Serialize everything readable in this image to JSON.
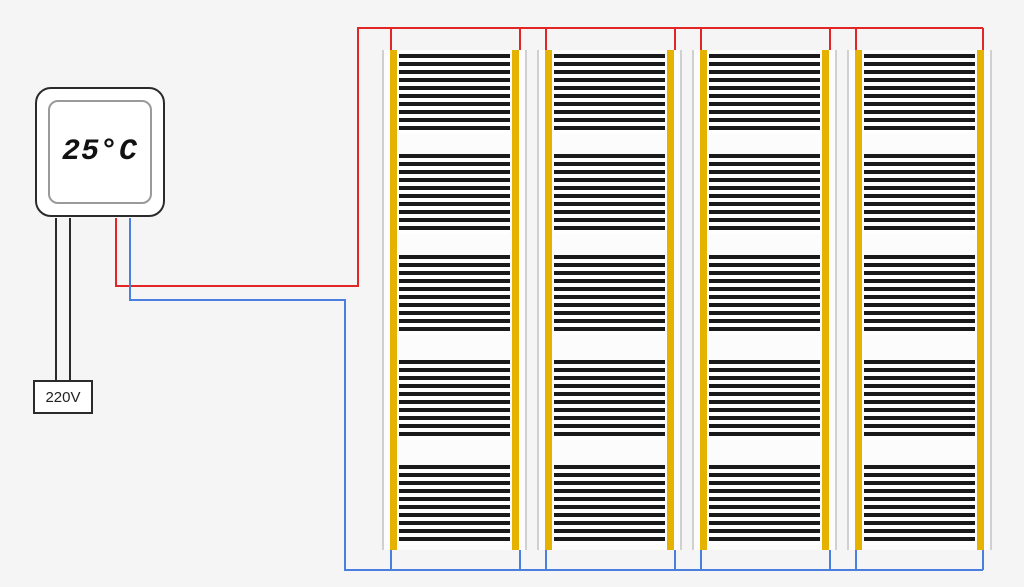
{
  "thermostat": {
    "display": "25°C"
  },
  "power_supply": {
    "label": "220V"
  },
  "wiring": {
    "hot_color": "#e22626",
    "neutral_color": "#4a7fe0",
    "mains_color": "#2b2b2b"
  },
  "panels": {
    "count": 4,
    "segments_per_panel": 5,
    "busbar_color": "#e6b200"
  }
}
